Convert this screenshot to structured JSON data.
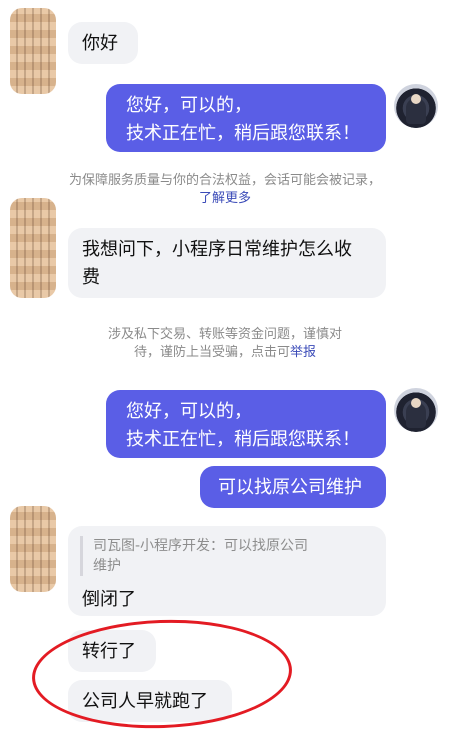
{
  "messages": {
    "m1": "你好",
    "m2_l1": "您好，可以的，",
    "m2_l2": "技术正在忙，稍后跟您联系！",
    "sys1_l1": "为保障服务质量与你的合法权益，会话可能会被记录，",
    "sys1_link": "了解更多",
    "m3_l1": "我想问下，小程序日常维护怎么收",
    "m3_l2": "费",
    "sys2_l1": "涉及私下交易、转账等资金问题，谨慎对",
    "sys2_l2_prefix": "待，谨防上当受骗，点击可",
    "sys2_link": "举报",
    "m4_l1": "您好，可以的，",
    "m4_l2": "技术正在忙，稍后跟您联系！",
    "m5": "可以找原公司维护",
    "quote_l1": "司瓦图-小程序开发：可以找原公司",
    "quote_l2": "维护",
    "m6": "倒闭了",
    "m7": "转行了",
    "m8": "公司人早就跑了"
  },
  "colors": {
    "outgoing_bubble": "#5a5ee6",
    "incoming_bubble": "#f1f2f5",
    "link": "#3b4bb8",
    "annotation_red": "#e31b23"
  }
}
